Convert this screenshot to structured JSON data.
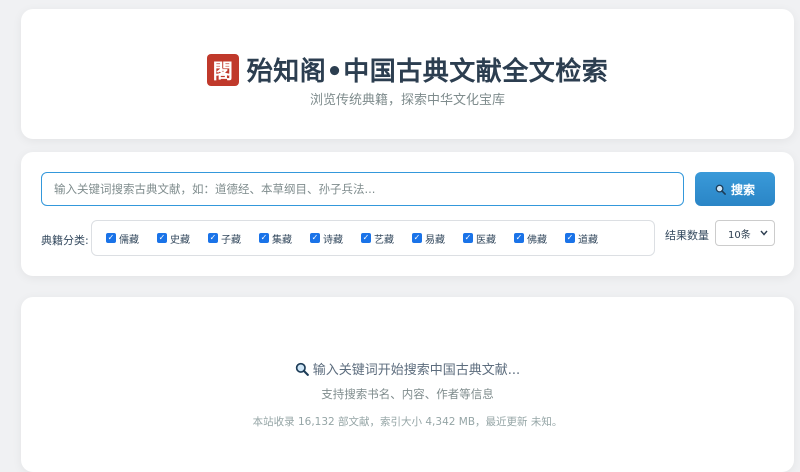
{
  "header": {
    "logo_char": "閣",
    "title": "殆知阁•中国古典文献全文检索",
    "subtitle": "浏览传统典籍，探索中华文化宝库"
  },
  "search": {
    "placeholder": "输入关键词搜索古典文献，如：道德经、本草纲目、孙子兵法...",
    "button_label": "搜索",
    "button_icon": "magnifier-icon",
    "category_label": "典籍分类:",
    "categories": [
      "儒藏",
      "史藏",
      "子藏",
      "集藏",
      "诗藏",
      "艺藏",
      "易藏",
      "医藏",
      "佛藏",
      "道藏"
    ],
    "count_label": "结果数量",
    "count_value": "10条"
  },
  "results": {
    "prompt": "输入关键词开始搜索中国古典文献...",
    "hint": "支持搜索书名、内容、作者等信息",
    "stats": "本站收录 16,132 部文献，索引大小 4,342 MB，最近更新 未知。"
  },
  "colors": {
    "accent": "#3498db",
    "logo_bg": "#c0392b",
    "checkbox": "#1a73e8"
  }
}
